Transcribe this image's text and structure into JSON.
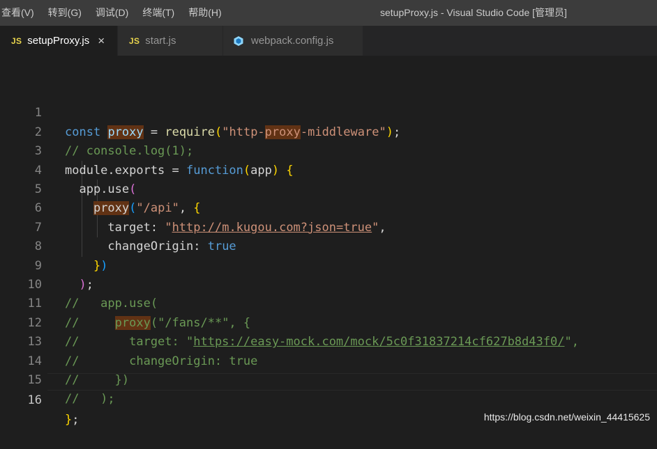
{
  "menu": {
    "items": [
      "查看(V)",
      "转到(G)",
      "调试(D)",
      "终端(T)",
      "帮助(H)"
    ],
    "window_title": "setupProxy.js - Visual Studio Code [管理员]"
  },
  "tabs": [
    {
      "label": "setupProxy.js",
      "icon": "JS",
      "active": true,
      "close": "×"
    },
    {
      "label": "start.js",
      "icon": "JS",
      "active": false
    },
    {
      "label": "webpack.config.js",
      "icon": "webpack-cube-icon",
      "active": false
    }
  ],
  "line_numbers": [
    "1",
    "2",
    "3",
    "4",
    "5",
    "6",
    "7",
    "8",
    "9",
    "10",
    "11",
    "12",
    "13",
    "14",
    "15",
    "16"
  ],
  "code": {
    "l1": {
      "const": "const",
      "proxy": "proxy",
      "eq": " = ",
      "require": "require",
      "p1": "(",
      "s1": "\"http-",
      "s2": "proxy",
      "s3": "-middleware\"",
      "p2": ")",
      "semi": ";"
    },
    "l2": {
      "comment": "// console.log(1);"
    },
    "l3": {
      "a": "module.exports = ",
      "function": "function",
      "p1": "(",
      "app": "app",
      "p2": ") ",
      "brace": "{"
    },
    "l4": {
      "indent": "  ",
      "a": "app.use",
      "p": "("
    },
    "l5": {
      "indent": "    ",
      "proxy": "proxy",
      "p1": "(",
      "str": "\"/api\"",
      "comma": ", ",
      "brace": "{"
    },
    "l6": {
      "indent": "      ",
      "key": "target: ",
      "q1": "\"",
      "url": "http://m.kugou.com?json=true",
      "q2": "\"",
      "comma": ","
    },
    "l7": {
      "indent": "      ",
      "key": "changeOrigin: ",
      "val": "true"
    },
    "l8": {
      "indent": "    ",
      "brace": "}",
      "p": ")"
    },
    "l9": {
      "indent": "  ",
      "p": ")",
      "semi": ";"
    },
    "l10": {
      "c": "//   app.use("
    },
    "l11": {
      "c1": "//     ",
      "proxy": "proxy",
      "c2": "(\"/fans/**\", {"
    },
    "l12": {
      "c1": "//       target: \"",
      "url": "https://easy-mock.com/mock/5c0f31837214cf627b8d43f0/",
      "c2": "\","
    },
    "l13": {
      "c": "//       changeOrigin: true"
    },
    "l14": {
      "c": "//     })"
    },
    "l15": {
      "c": "//   );"
    },
    "l16": {
      "brace": "}",
      "semi": ";"
    }
  },
  "watermark": "https://blog.csdn.net/weixin_44415625",
  "colors": {
    "menubar": "#3c3c3c",
    "editor_bg": "#1e1e1e",
    "keyword": "#569cd6",
    "function": "#dcdcaa",
    "string": "#ce9178",
    "comment": "#6a9955",
    "highlight": "#613214"
  }
}
